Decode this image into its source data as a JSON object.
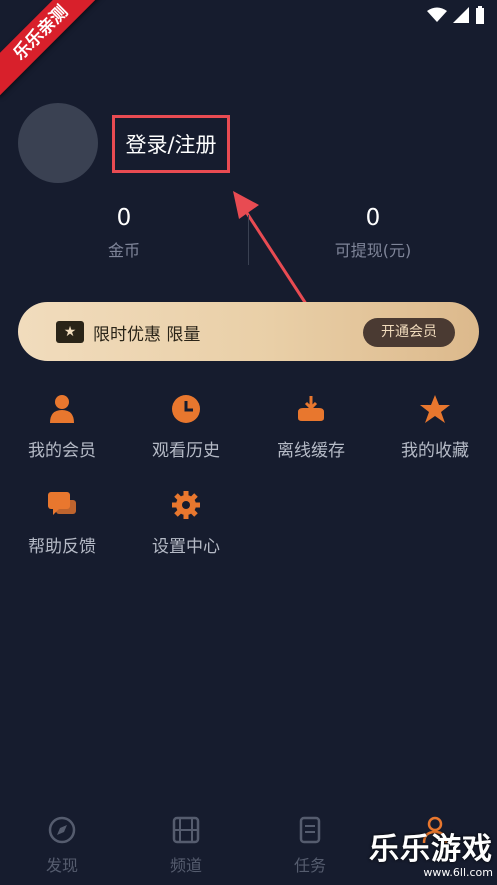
{
  "ribbon": {
    "text": "乐乐亲测"
  },
  "profile": {
    "login_label": "登录/注册"
  },
  "stats": [
    {
      "value": "0",
      "label": "金币"
    },
    {
      "value": "0",
      "label": "可提现(元)"
    }
  ],
  "banner": {
    "text": "限时优惠 限量",
    "button": "开通会员"
  },
  "menu": [
    {
      "label": "我的会员",
      "icon": "person-icon"
    },
    {
      "label": "观看历史",
      "icon": "clock-icon"
    },
    {
      "label": "离线缓存",
      "icon": "download-icon"
    },
    {
      "label": "我的收藏",
      "icon": "star-icon"
    },
    {
      "label": "帮助反馈",
      "icon": "chat-icon"
    },
    {
      "label": "设置中心",
      "icon": "gear-icon"
    }
  ],
  "nav": [
    {
      "label": "发现",
      "icon": "compass-icon"
    },
    {
      "label": "频道",
      "icon": "film-icon"
    },
    {
      "label": "任务",
      "icon": "task-icon"
    }
  ],
  "watermark": {
    "title": "乐乐游戏",
    "url": "www.6ll.com"
  },
  "colors": {
    "accent": "#e8772e",
    "background": "#161c2e",
    "highlight_box": "#e84b52"
  }
}
